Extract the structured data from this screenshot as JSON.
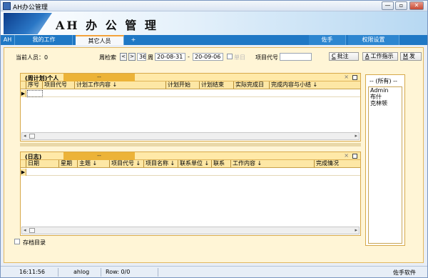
{
  "window": {
    "title": "AH办公管理",
    "min_symbol": "—",
    "max_symbol": "▫",
    "close_symbol": "✕"
  },
  "banner": {
    "title": "AH 办 公 管 理"
  },
  "tabs": {
    "left": [
      "AH",
      "我的工作",
      "其它人员",
      "+"
    ],
    "right": [
      "佐手",
      "权限设置"
    ],
    "active_index": 2
  },
  "toolbar": {
    "current_person_label": "当前人员：0",
    "week_search_label": "周检索",
    "prev": "<",
    "next": ">",
    "week_number": "36",
    "week_suffix": "周",
    "date_from": "20-08-31",
    "date_sep": "-",
    "date_to": "20-09-06",
    "day_label": "单日",
    "project_code_label": "项目代号",
    "project_code_value": "",
    "buttons": [
      {
        "key": "C",
        "label": "批注"
      },
      {
        "key": "A",
        "label": "工作指示"
      },
      {
        "key": "M",
        "label": "发"
      }
    ]
  },
  "weekly_panel": {
    "title": "(周计划)个人",
    "tab": "--",
    "close": "×",
    "columns": [
      "序号",
      "项目代号",
      "计划工作内容 ↓",
      "计划开始",
      "计划结束",
      "实际完成日",
      "完成内容与小结 ↓"
    ],
    "row_marker": "▶"
  },
  "log_panel": {
    "title": "(日志)",
    "tab": "--",
    "close": "×",
    "columns": [
      "日期",
      "星期",
      "主题 ↓",
      "项目代号 ↓",
      "项目名称 ↓",
      "联系单位 ↓",
      "联系",
      "工作内容 ↓",
      "完成情况"
    ],
    "row_marker": "▶"
  },
  "side_panel": {
    "title": "-- (所有) --",
    "items": [
      "Admin",
      "布什",
      "克林顿"
    ]
  },
  "archive_label": "存档目录",
  "statusbar": {
    "time": "16:11:56",
    "user": "ahlog",
    "row": "Row: 0/0",
    "brand": "佐手软件"
  }
}
